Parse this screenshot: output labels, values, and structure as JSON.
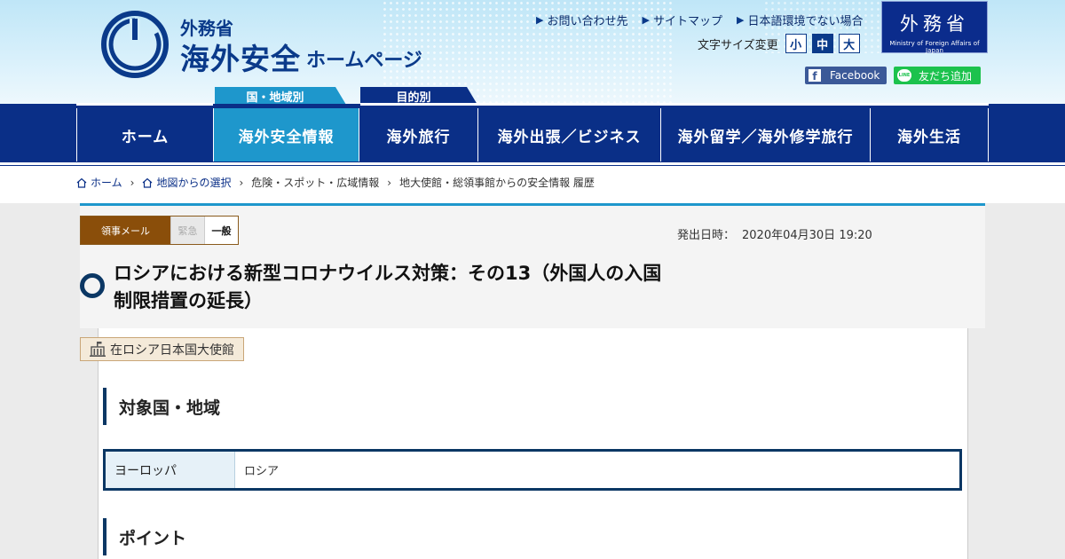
{
  "header": {
    "ministry": "外務省",
    "title": "海外安全",
    "subtitle": "ホームページ",
    "util_links": [
      "お問い合わせ先",
      "サイトマップ",
      "日本語環境でない場合"
    ],
    "font_size_label": "文字サイズ変更",
    "font_sizes": [
      "小",
      "中",
      "大"
    ],
    "font_size_selected": "中",
    "mofa_logo_jp": "外務省",
    "mofa_logo_en": "Ministry of Foreign Affairs of Japan",
    "facebook_label": "Facebook",
    "line_label": "友だち追加",
    "line_icon_text": "LINE"
  },
  "nav": {
    "tab_region": "国・地域別",
    "tab_purpose": "目的別",
    "items": [
      "ホーム",
      "海外安全情報",
      "海外旅行",
      "海外出張／ビジネス",
      "海外留学／海外修学旅行",
      "海外生活"
    ],
    "active": "海外安全情報"
  },
  "breadcrumb": [
    "ホーム",
    "地図からの選択",
    "危険・スポット・広域情報",
    "地大使館・総領事館からの安全情報 履歴"
  ],
  "notice": {
    "tag_mail": "領事メール",
    "tag_urgent": "緊急",
    "tag_normal": "一般",
    "issued_label": "発出日時：",
    "issued_date": "2020年04月30日 19:20",
    "title_line1": "ロシアにおける新型コロナウイルス対策：その13（外国人の入国",
    "title_line2": "制限措置の延長）",
    "embassy": "在ロシア日本国大使館"
  },
  "sections": {
    "target_heading": "対象国・地域",
    "region_label": "ヨーロッパ",
    "country": "ロシア",
    "point_heading": "ポイント"
  },
  "colors": {
    "navy": "#0a2f87",
    "cyan": "#1e97cc",
    "mail_brown": "#8a4e0a",
    "facebook": "#3b5998",
    "line": "#1cc24d"
  }
}
